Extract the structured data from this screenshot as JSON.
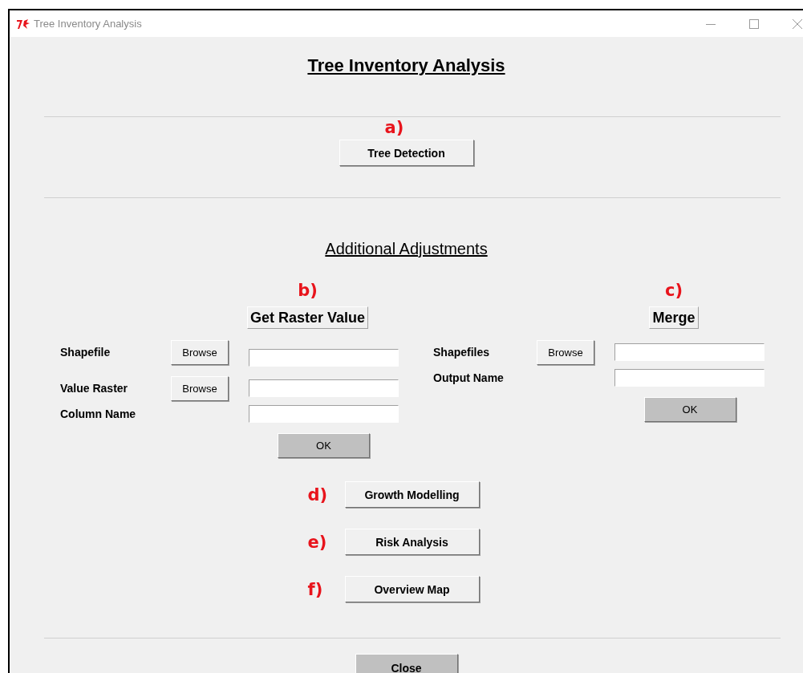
{
  "window": {
    "title": "Tree Inventory Analysis"
  },
  "heading": "Tree Inventory Analysis",
  "detection": {
    "marker": "a)",
    "button": "Tree Detection"
  },
  "subheading": "Additional Adjustments",
  "panels": [
    {
      "marker": "b)",
      "title": "Get Raster Value",
      "rows": [
        {
          "label": "Shapefile",
          "browse": "Browse"
        },
        {
          "label": "Value Raster",
          "browse": "Browse"
        },
        {
          "label": "Column Name"
        }
      ],
      "ok": "OK"
    },
    {
      "marker": "c)",
      "title": "Merge",
      "rows": [
        {
          "label": "Shapefiles",
          "browse": "Browse"
        },
        {
          "label": "Output Name"
        }
      ],
      "ok": "OK"
    }
  ],
  "tools": [
    {
      "marker": "d)",
      "button": "Growth Modelling"
    },
    {
      "marker": "e)",
      "button": "Risk Analysis"
    },
    {
      "marker": "f)",
      "button": "Overview Map"
    }
  ],
  "close": "Close"
}
